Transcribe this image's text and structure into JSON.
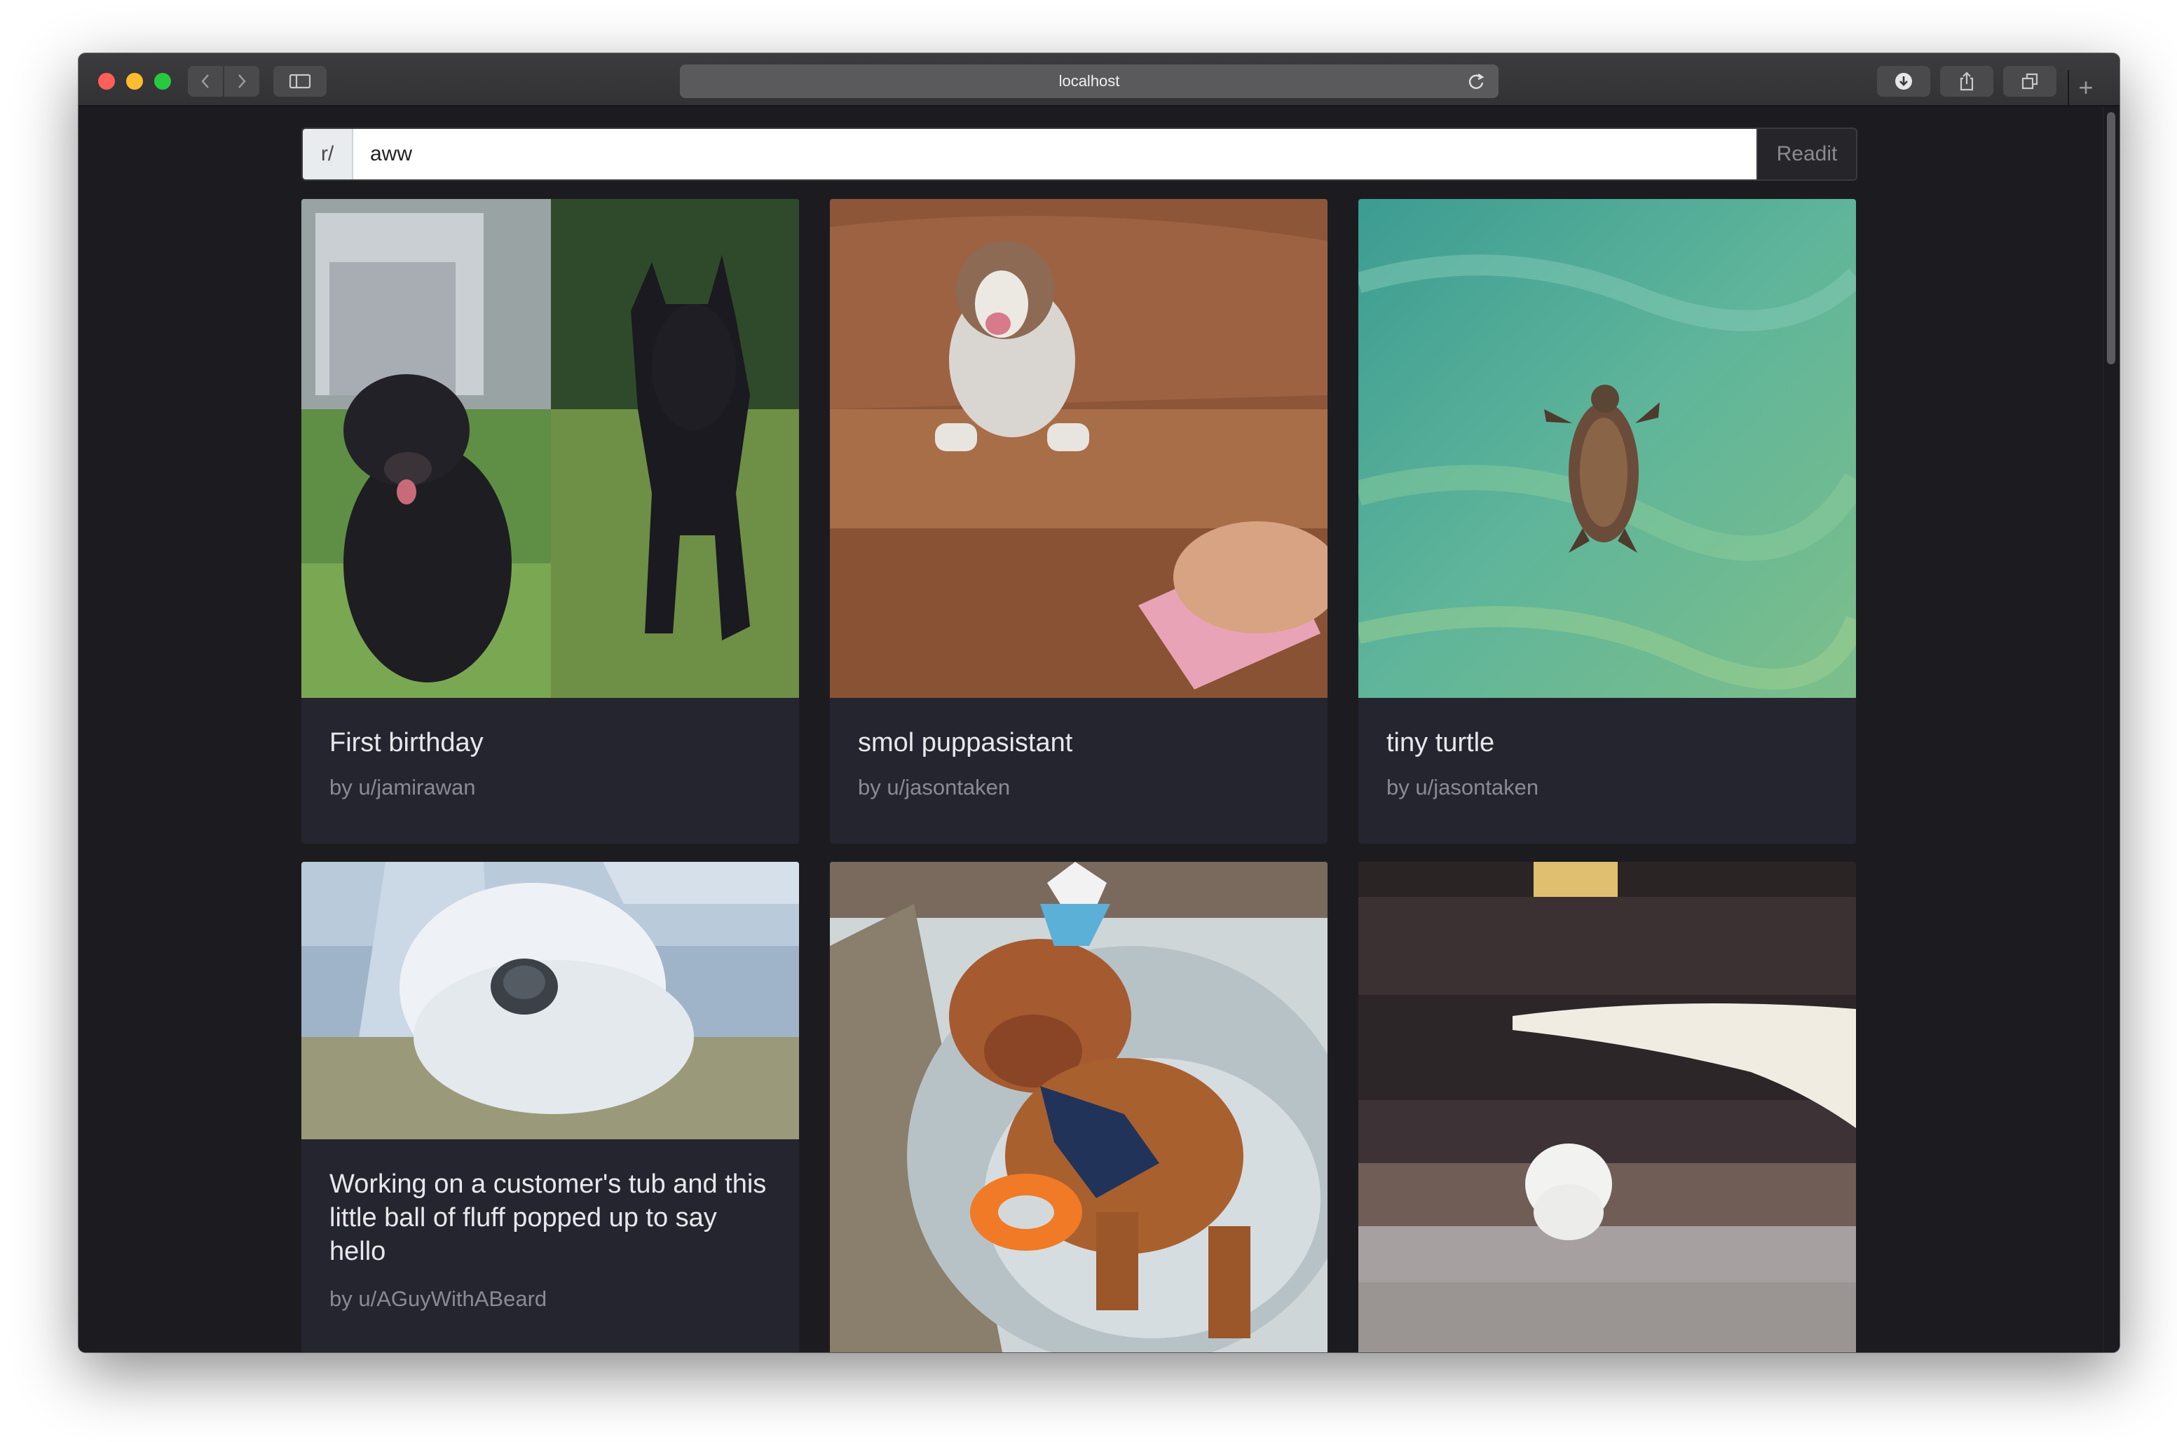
{
  "browser": {
    "url": "localhost",
    "new_tab_symbol": "+"
  },
  "search": {
    "prefix": "r/",
    "value": "aww",
    "button_label": "Readit"
  },
  "posts": [
    {
      "title": "First birthday",
      "author": "by u/jamirawan"
    },
    {
      "title": "smol puppasistant",
      "author": "by u/jasontaken"
    },
    {
      "title": "tiny turtle",
      "author": "by u/jasontaken"
    },
    {
      "title": "Working on a customer's tub and this little ball of fluff popped up to say hello",
      "author": "by u/AGuyWithABeard"
    },
    {
      "title": "",
      "author": ""
    },
    {
      "title": "",
      "author": ""
    }
  ],
  "colors": {
    "background": "#1c1c20",
    "card": "#25252f",
    "title_text": "#e8e8ec",
    "author_text": "#8a8a94"
  }
}
